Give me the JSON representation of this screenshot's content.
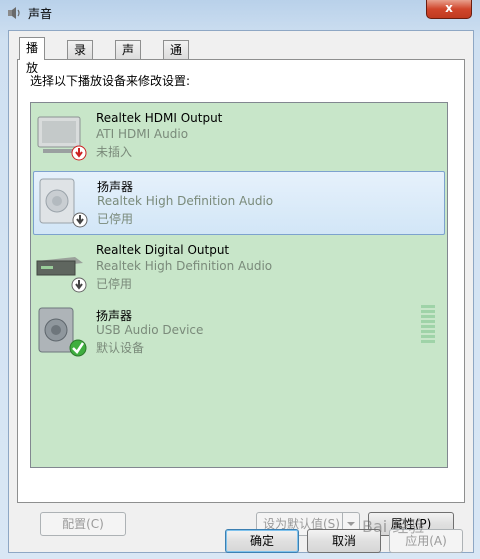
{
  "window": {
    "title": "声音",
    "close_label": "x"
  },
  "tabs": [
    {
      "label": "播放"
    },
    {
      "label": "录制"
    },
    {
      "label": "声音"
    },
    {
      "label": "通信"
    }
  ],
  "instruction": "选择以下播放设备来修改设置:",
  "devices": [
    {
      "name": "Realtek HDMI Output",
      "driver": "ATI HDMI Audio",
      "status": "未插入",
      "icon": "monitor-icon",
      "badge": "unplugged-badge-icon"
    },
    {
      "name": "扬声器",
      "driver": "Realtek High Definition Audio",
      "status": "已停用",
      "icon": "speaker-icon",
      "badge": "disabled-badge-icon"
    },
    {
      "name": "Realtek Digital Output",
      "driver": "Realtek High Definition Audio",
      "status": "已停用",
      "icon": "digital-output-icon",
      "badge": "disabled-badge-icon"
    },
    {
      "name": "扬声器",
      "driver": "USB Audio Device",
      "status": "默认设备",
      "icon": "speaker-icon",
      "badge": "default-check-icon"
    }
  ],
  "buttons": {
    "configure": "配置(C)",
    "set_default": "设为默认值(S)",
    "properties": "属性(P)",
    "ok": "确定",
    "cancel": "取消",
    "apply": "应用(A)"
  },
  "watermark": {
    "text": "Bai 经验"
  }
}
